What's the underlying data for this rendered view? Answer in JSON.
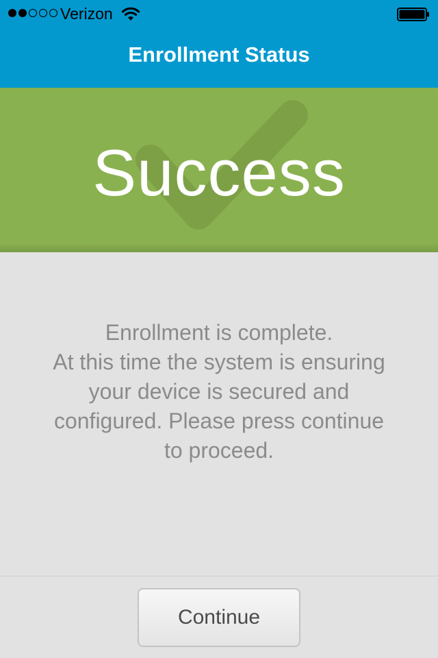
{
  "status_bar": {
    "carrier": "Verizon",
    "signal_bars_filled": 2,
    "signal_bars_total": 5,
    "icons": [
      "signal-dots-icon",
      "wifi-icon",
      "battery-icon"
    ]
  },
  "nav": {
    "title": "Enrollment Status"
  },
  "banner": {
    "text": "Success",
    "icon": "checkmark-icon",
    "color": "#8ab14f"
  },
  "message": {
    "lines": [
      "Enrollment is complete.",
      "At this time the system is ensuring",
      "your device is secured and",
      "configured. Please press continue",
      "to proceed."
    ]
  },
  "footer": {
    "continue_label": "Continue"
  },
  "colors": {
    "header": "#0399cf",
    "background": "#e2e2e2",
    "message_text": "#8b8b8b"
  }
}
